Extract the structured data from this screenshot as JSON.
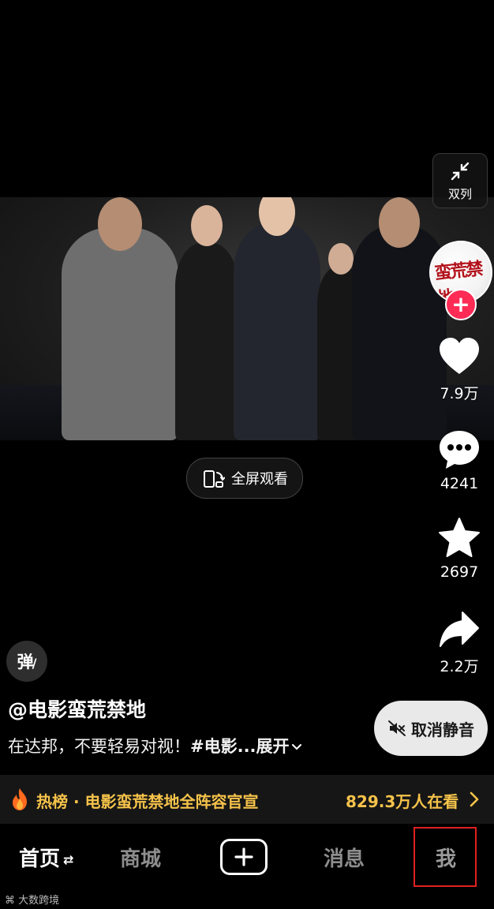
{
  "side_actions": {
    "double_column_label": "双列",
    "likes": "7.9万",
    "comments": "4241",
    "favorites": "2697",
    "shares": "2.2万",
    "avatar_logo_text": "蛮荒禁地"
  },
  "video": {
    "fullscreen_label": "全屏观看"
  },
  "danmaku_label": "弹",
  "post": {
    "author": "@电影蛮荒禁地",
    "caption_text": "在达邦，不要轻易对视！",
    "caption_tag": "#电影...",
    "expand_label": "展开"
  },
  "unmute_label": "取消静音",
  "hotbar": {
    "text": "热榜 · 电影蛮荒禁地全阵容官宣",
    "viewers": "829.3万人在看"
  },
  "nav": {
    "home": "首页",
    "mall": "商城",
    "messages": "消息",
    "me": "我"
  },
  "watermark": "大数跨境",
  "colors": {
    "follow_red": "#fe2c55",
    "hot_gold": "#f6c34a",
    "highlight_red": "#e02020"
  }
}
